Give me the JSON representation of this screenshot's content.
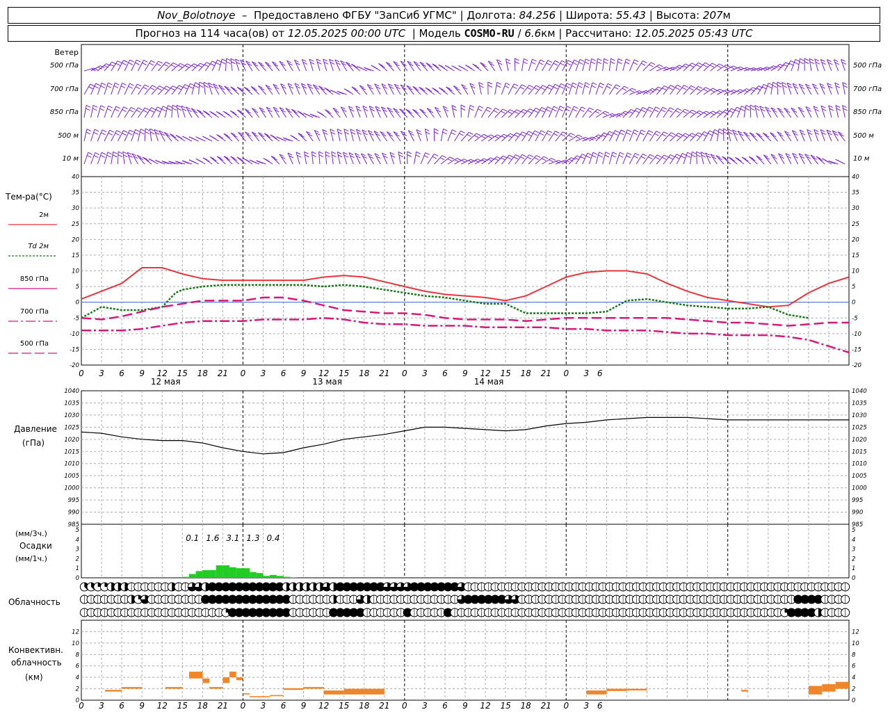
{
  "header": {
    "station": "Nov_Bolotnoye",
    "provider": "Предоставлено ФГБУ \"ЗапСиб УГМС\"",
    "lon_label": "Долгота:",
    "lon": "84.256",
    "lat_label": "Широта:",
    "lat": "55.43",
    "alt_label": "Высота:",
    "alt": "207",
    "alt_unit": "м",
    "forecast_label": "Прогноз на 114 часа(ов) от",
    "forecast_time": "12.05.2025 00:00 UTC",
    "model_label": "Модель",
    "model": "COSMO-RU",
    "model_res": "6.6",
    "model_unit": "км",
    "calc_label": "Рассчитано:",
    "calc_time": "12.05.2025 05:43 UTC"
  },
  "time_axis": {
    "hour_ticks": [
      "0",
      "3",
      "6",
      "9",
      "12",
      "15",
      "18",
      "21",
      "0",
      "3",
      "6",
      "9",
      "12",
      "15",
      "18",
      "21",
      "0",
      "3",
      "6",
      "9",
      "12",
      "15",
      "18",
      "21",
      "0",
      "3",
      "6"
    ],
    "days": [
      "12 мая",
      "13 мая",
      "14 мая"
    ]
  },
  "wind_panel": {
    "title": "Ветер",
    "levels": [
      "500 гПа",
      "700 гПа",
      "850 гПа",
      "500 м",
      "10 м"
    ],
    "color": "#7b22d6"
  },
  "temp_panel": {
    "title": "Тем-ра(°C)",
    "legend": [
      {
        "label": "2м",
        "color": "#e8353b",
        "style": "solid"
      },
      {
        "label": "Td 2м",
        "color": "#1a7a1a",
        "style": "dotted"
      },
      {
        "label": "850 гПа",
        "color": "#d6187a",
        "style": "solid"
      },
      {
        "label": "700 гПа",
        "color": "#d6187a",
        "style": "dashdot"
      },
      {
        "label": "500 гПа",
        "color": "#d6187a",
        "style": "dash"
      }
    ],
    "y_ticks": [
      "40",
      "35",
      "30",
      "25",
      "20",
      "15",
      "10",
      "5",
      "0",
      "-5",
      "-10",
      "-15",
      "-20"
    ]
  },
  "pressure_panel": {
    "title": "Давление",
    "unit": "(гПа)",
    "y_ticks": [
      "1040",
      "1035",
      "1030",
      "1025",
      "1020",
      "1015",
      "1010",
      "1005",
      "1000",
      "995",
      "990",
      "985"
    ]
  },
  "precip_panel": {
    "title": "Осадки",
    "unit3": "(мм/3ч.)",
    "unit1": "(мм/1ч.)",
    "y_ticks": [
      "5",
      "4",
      "3",
      "2",
      "1",
      "0"
    ],
    "totals_3h": [
      {
        "hour": 18,
        "value": "0.1"
      },
      {
        "hour": 21,
        "value": "1.6"
      },
      {
        "hour": 24,
        "value": "3.1"
      },
      {
        "hour": 27,
        "value": "1.3"
      },
      {
        "hour": 30,
        "value": "0.4"
      }
    ],
    "color": "#22cc22"
  },
  "cloud_panel": {
    "title": "Облачность"
  },
  "conv_panel": {
    "title_lines": [
      "Конвективн.",
      "облачность",
      "(км)"
    ],
    "y_ticks": [
      "12",
      "10",
      "8",
      "6",
      "4",
      "2",
      "0"
    ],
    "color": "#f0862a"
  },
  "chart_data": {
    "type": "line",
    "x_unit": "hours from 12.05.2025 00:00 UTC",
    "x_range": [
      0,
      114
    ],
    "temperature": {
      "ylim": [
        -20,
        40
      ],
      "series": [
        {
          "name": "2м",
          "x": [
            0,
            6,
            9,
            12,
            15,
            18,
            21,
            24,
            27,
            30,
            33,
            36,
            39,
            42,
            45,
            48,
            51,
            54,
            57,
            60,
            63,
            66,
            69,
            72,
            75,
            78,
            81,
            84,
            87,
            90,
            93,
            96,
            99,
            102,
            105,
            108,
            111,
            114
          ],
          "values": [
            1,
            6,
            11,
            11,
            9,
            7.5,
            7,
            7,
            7,
            7,
            7,
            8,
            8.5,
            8,
            6.5,
            5,
            3.5,
            2.5,
            2,
            1.5,
            0.5,
            2,
            5,
            8,
            9.5,
            10,
            10,
            9,
            6,
            3.5,
            1.5,
            0.5,
            -0.5,
            -1.5,
            -1,
            3,
            6,
            8
          ]
        },
        {
          "name": "Td 2м",
          "x": [
            0,
            3,
            6,
            9,
            12,
            14,
            15,
            18,
            21,
            24,
            27,
            30,
            33,
            36,
            39,
            42,
            45,
            48,
            51,
            54,
            57,
            60,
            63,
            66,
            69,
            72,
            75,
            78,
            81,
            84,
            87,
            90,
            93,
            96,
            99,
            102,
            105,
            108,
            111,
            114
          ],
          "values": [
            -5,
            -1.5,
            -2.5,
            -2.5,
            -1.5,
            3,
            4,
            5,
            5.5,
            5.5,
            5.5,
            5.5,
            5.5,
            5,
            5.5,
            5,
            4,
            3,
            2,
            1.5,
            0.5,
            -0.5,
            -0.5,
            -3.5,
            -3.5,
            -3.5,
            -3.5,
            -3,
            0.5,
            1,
            0,
            -1,
            -1.5,
            -2,
            -2,
            -1.5,
            -4,
            -5
          ]
        },
        {
          "name": "850 гПа",
          "x": [
            0,
            3,
            6,
            9,
            12,
            15,
            18,
            21,
            24,
            27,
            30,
            33,
            36,
            39,
            42,
            45,
            48,
            51,
            54,
            57,
            60,
            63,
            66,
            69,
            72,
            75,
            78,
            81,
            84,
            87,
            90,
            93,
            96,
            99,
            102,
            105,
            108,
            111,
            114
          ],
          "values": [
            -5,
            -5.5,
            -4.5,
            -3,
            -1.5,
            -0.5,
            0.5,
            0.5,
            0.5,
            1.5,
            1.5,
            0.5,
            -1,
            -2.5,
            -3,
            -3.5,
            -3.5,
            -4,
            -5,
            -5.5,
            -5.5,
            -5.5,
            -6,
            -5.5,
            -5,
            -5,
            -5,
            -5,
            -5,
            -5,
            -5.5,
            -6,
            -6.5,
            -6.5,
            -7,
            -7.5,
            -7,
            -6.5,
            -6.5
          ]
        },
        {
          "name": "700 гПа",
          "x": [
            0,
            6,
            9,
            12,
            15,
            18,
            21,
            24,
            27,
            30,
            33,
            36,
            39,
            42,
            45,
            48,
            51,
            54,
            57,
            60,
            63,
            66,
            69,
            72,
            75,
            78,
            81,
            84,
            87,
            90,
            93,
            96,
            99,
            102,
            105,
            108,
            111,
            114
          ],
          "values": [
            -9,
            -9,
            -8.5,
            -7.5,
            -6.5,
            -6,
            -6,
            -6,
            -5.5,
            -5.5,
            -5.5,
            -5,
            -5.5,
            -6.5,
            -7,
            -7,
            -7.5,
            -7.5,
            -7.5,
            -8,
            -8,
            -8,
            -8,
            -8.5,
            -8.5,
            -9,
            -9,
            -9,
            -9.5,
            -10,
            -10,
            -10.5,
            -10.5,
            -10.5,
            -11,
            -12,
            -14,
            -16
          ]
        },
        {
          "name": "500 гПа",
          "x": [],
          "values": []
        }
      ]
    },
    "pressure": {
      "ylim": [
        985,
        1040
      ],
      "x": [
        0,
        3,
        6,
        9,
        12,
        15,
        18,
        21,
        24,
        27,
        30,
        33,
        36,
        39,
        42,
        45,
        48,
        51,
        54,
        57,
        60,
        63,
        66,
        69,
        72,
        75,
        78,
        81,
        84,
        87,
        90,
        93,
        96,
        99,
        102,
        105,
        108,
        111,
        114
      ],
      "values": [
        1023,
        1022.5,
        1021,
        1020,
        1019.5,
        1019.5,
        1018.5,
        1016.5,
        1015,
        1014,
        1014.5,
        1016.5,
        1018,
        1020,
        1021,
        1022,
        1023.5,
        1025,
        1025,
        1024.5,
        1024,
        1023.5,
        1024,
        1025.5,
        1026.5,
        1027,
        1028,
        1028.5,
        1029,
        1029,
        1029,
        1028.5,
        1028,
        1028,
        1028,
        1028,
        1028,
        1028,
        1028
      ]
    },
    "precip_1h": {
      "ylim": [
        0,
        5
      ],
      "x": [
        16,
        17,
        18,
        19,
        20,
        21,
        22,
        23,
        24,
        25,
        26,
        27,
        28,
        29,
        30,
        31,
        32
      ],
      "values": [
        0.1,
        0.4,
        0.7,
        0.8,
        0.8,
        1.3,
        1.3,
        1.1,
        1.0,
        1.0,
        0.6,
        0.5,
        0.2,
        0.3,
        0.2,
        0.1,
        0.05
      ]
    },
    "convective_cloud_km": {
      "ylim": [
        0,
        12
      ],
      "segments": [
        {
          "x0": 3.5,
          "x1": 6,
          "bottom": 1.5,
          "top": 1.8
        },
        {
          "x0": 6,
          "x1": 9,
          "bottom": 2,
          "top": 2.3
        },
        {
          "x0": 12.5,
          "x1": 15,
          "bottom": 2,
          "top": 2.3
        },
        {
          "x0": 16,
          "x1": 18,
          "bottom": 3.8,
          "top": 5
        },
        {
          "x0": 18,
          "x1": 19,
          "bottom": 3,
          "top": 3.8
        },
        {
          "x0": 19,
          "x1": 21,
          "bottom": 2,
          "top": 2.3
        },
        {
          "x0": 21,
          "x1": 22,
          "bottom": 3,
          "top": 4
        },
        {
          "x0": 22,
          "x1": 23,
          "bottom": 4,
          "top": 5
        },
        {
          "x0": 23,
          "x1": 24,
          "bottom": 3.5,
          "top": 4
        },
        {
          "x0": 24,
          "x1": 25,
          "bottom": 1,
          "top": 1.2
        },
        {
          "x0": 25,
          "x1": 28,
          "bottom": 0.5,
          "top": 0.7
        },
        {
          "x0": 28,
          "x1": 30,
          "bottom": 0.7,
          "top": 0.9
        },
        {
          "x0": 30,
          "x1": 33,
          "bottom": 1.8,
          "top": 2.1
        },
        {
          "x0": 33,
          "x1": 36,
          "bottom": 2,
          "top": 2.3
        },
        {
          "x0": 36,
          "x1": 39,
          "bottom": 1,
          "top": 1.7
        },
        {
          "x0": 39,
          "x1": 42,
          "bottom": 1,
          "top": 2
        },
        {
          "x0": 42,
          "x1": 45,
          "bottom": 1,
          "top": 2
        },
        {
          "x0": 75,
          "x1": 78,
          "bottom": 1,
          "top": 1.7
        },
        {
          "x0": 78,
          "x1": 81,
          "bottom": 1.6,
          "top": 2
        },
        {
          "x0": 81,
          "x1": 84,
          "bottom": 1.7,
          "top": 2
        },
        {
          "x0": 98,
          "x1": 99,
          "bottom": 1.5,
          "top": 1.8
        },
        {
          "x0": 108,
          "x1": 110,
          "bottom": 1,
          "top": 2.5
        },
        {
          "x0": 110,
          "x1": 112,
          "bottom": 1.5,
          "top": 2.8
        },
        {
          "x0": 112,
          "x1": 114,
          "bottom": 2,
          "top": 3.2
        }
      ]
    },
    "cloud_cover_eighths": {
      "x_start": 0,
      "x_step": 1,
      "count": 114,
      "rows": [
        "3322444000000400664888888888884444446488888886666888888860000000000000000000000000000000000000000000000000000000",
        "0000000426000000008888888888888000000400064000000000000068888886600000000000000000000000000000000000000000888800",
        "0000000000000000000002888888888000000888880000008000008000000000000000000000000000000000000000000000000028888400"
      ]
    }
  }
}
